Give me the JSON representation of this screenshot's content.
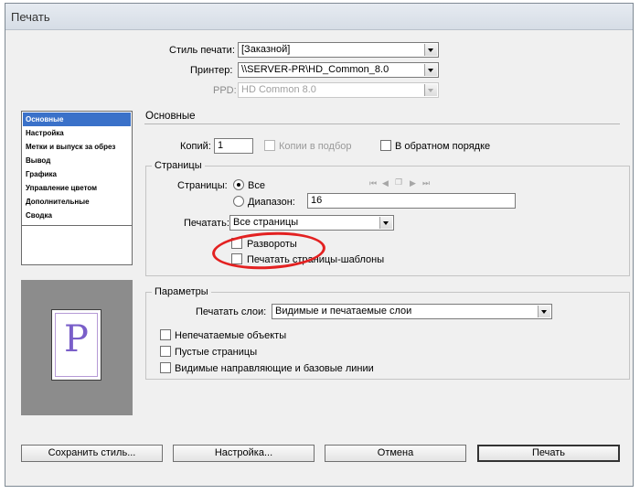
{
  "window": {
    "title": "Печать"
  },
  "header": {
    "style": {
      "label": "Стиль печати:",
      "value": "[Заказной]"
    },
    "printer": {
      "label": "Принтер:",
      "value": "\\\\SERVER-PR\\HD_Common_8.0"
    },
    "ppd": {
      "label": "PPD:",
      "value": "HD Common 8.0"
    }
  },
  "sidebar": {
    "items": [
      {
        "label": "Основные"
      },
      {
        "label": "Настройка"
      },
      {
        "label": "Метки и выпуск за обрез"
      },
      {
        "label": "Вывод"
      },
      {
        "label": "Графика"
      },
      {
        "label": "Управление цветом"
      },
      {
        "label": "Дополнительные"
      },
      {
        "label": "Сводка"
      }
    ],
    "preview_letter": "P"
  },
  "main": {
    "section_title": "Основные",
    "copies": {
      "label": "Копий:",
      "value": "1",
      "collate_label": "Копии в подбор",
      "reverse_label": "В обратном порядке"
    },
    "pages": {
      "title": "Страницы",
      "pages_label": "Страницы:",
      "all_label": "Все",
      "range_label": "Диапазон:",
      "range_value": "16",
      "print_label": "Печатать:",
      "print_value": "Все страницы",
      "spreads_label": "Развороты",
      "masters_label": "Печатать страницы-шаблоны"
    },
    "options": {
      "title": "Параметры",
      "layers_label": "Печатать слои:",
      "layers_value": "Видимые и печатаемые слои",
      "nonprint_label": "Непечатаемые объекты",
      "blank_label": "Пустые страницы",
      "guides_label": "Видимые направляющие и базовые линии"
    }
  },
  "footer": {
    "save_style": "Сохранить стиль...",
    "setup": "Настройка...",
    "cancel": "Отмена",
    "print": "Печать"
  },
  "colors": {
    "accent": "#3a71c9",
    "annotation": "#e32121"
  }
}
